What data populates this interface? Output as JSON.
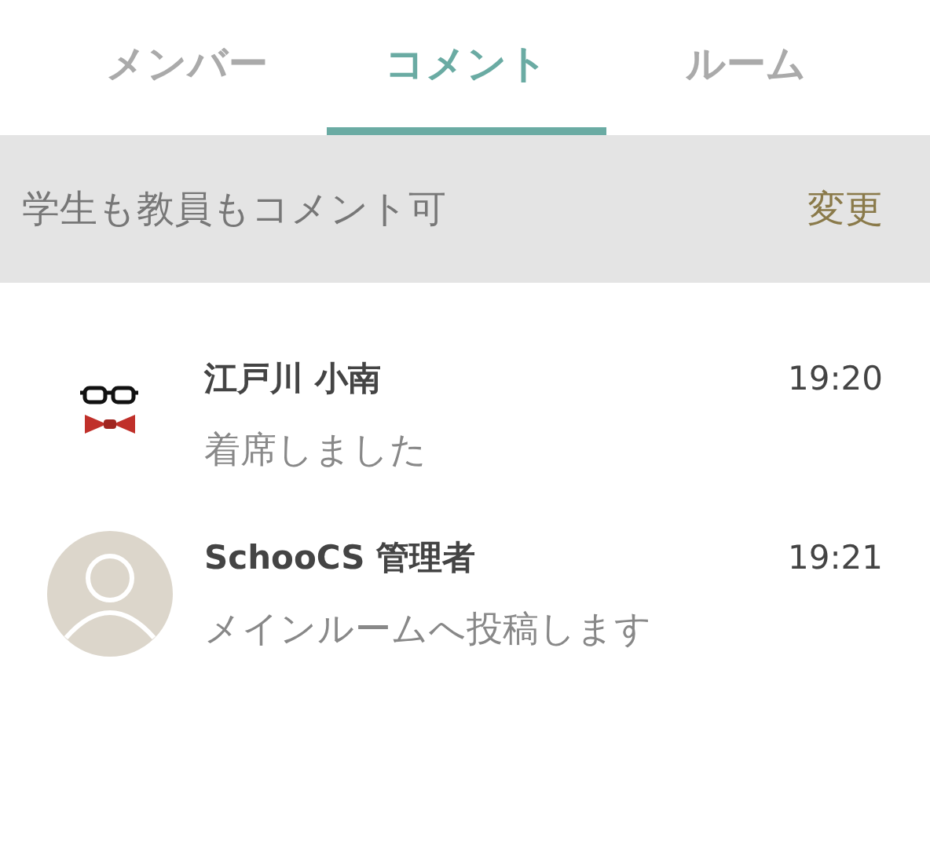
{
  "tabs": [
    {
      "label": "メンバー",
      "selected": false
    },
    {
      "label": "コメント",
      "selected": true
    },
    {
      "label": "ルーム",
      "selected": false
    }
  ],
  "setting": {
    "text": "学生も教員もコメント可",
    "action": "変更"
  },
  "comments": [
    {
      "kind": "glasses",
      "name": "江戸川 小南",
      "time": "19:20",
      "message": "着席しました"
    },
    {
      "kind": "default",
      "name": "SchooCS 管理者",
      "time": "19:21",
      "message": "メインルームへ投稿します"
    }
  ]
}
